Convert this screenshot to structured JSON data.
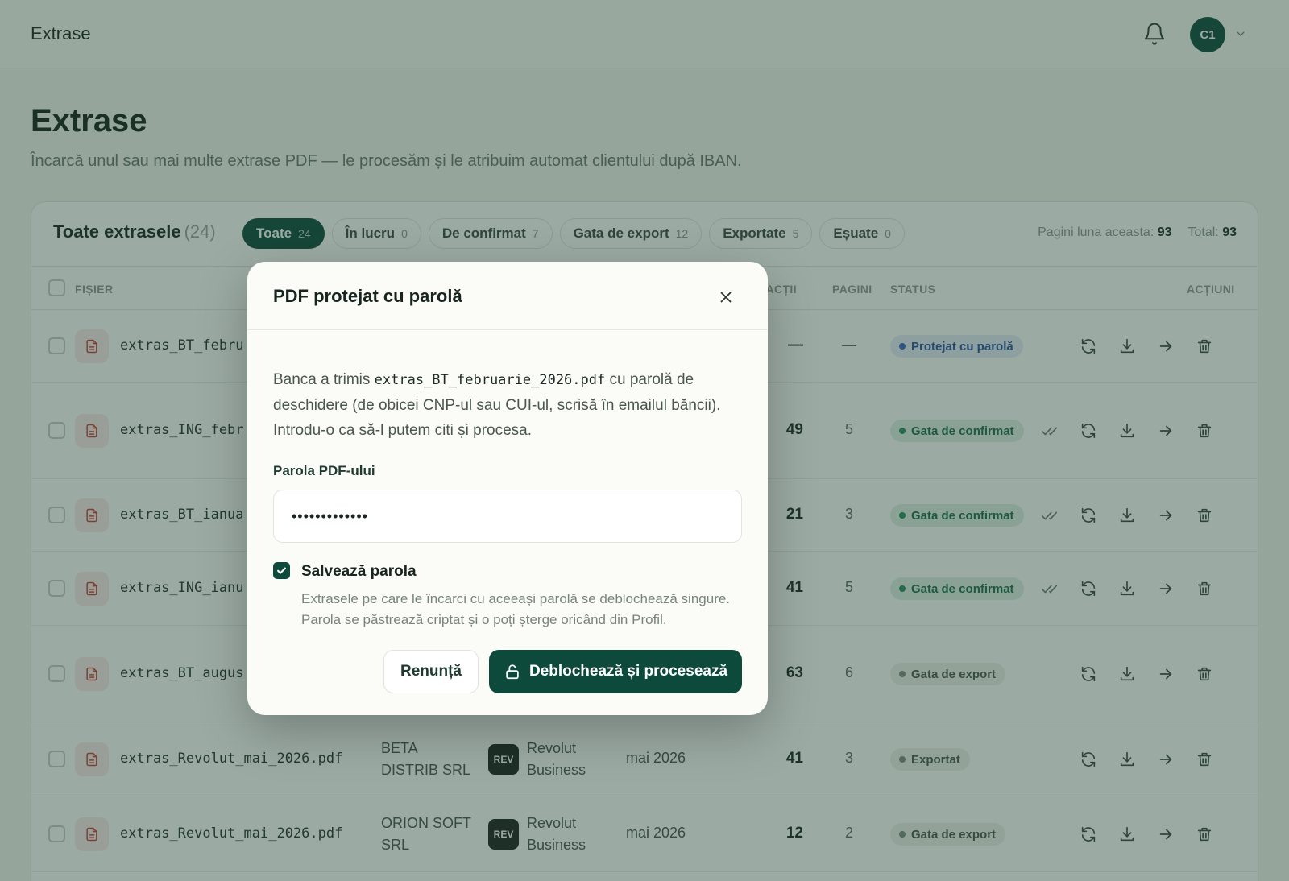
{
  "app": {
    "title": "Extrase",
    "avatar_initials": "C1"
  },
  "page": {
    "title": "Extrase",
    "subtitle": "Încarcă unul sau mai multe extrase PDF — le procesăm și le atribuim automat clientului după IBAN."
  },
  "card": {
    "title": "Toate extrasele",
    "count": "(24)",
    "tabs": [
      {
        "label": "Toate",
        "count": "24",
        "active": true
      },
      {
        "label": "În lucru",
        "count": "0"
      },
      {
        "label": "De confirmat",
        "count": "7"
      },
      {
        "label": "Gata de export",
        "count": "12"
      },
      {
        "label": "Exportate",
        "count": "5"
      },
      {
        "label": "Eșuate",
        "count": "0"
      }
    ],
    "stats": {
      "month_label": "Pagini luna aceasta:",
      "month_value": "93",
      "total_label": "Total:",
      "total_value": "93"
    }
  },
  "table": {
    "headers": {
      "file": "FIȘIER",
      "transactions": "NZACȚII",
      "pages": "PAGINI",
      "status": "STATUS",
      "actions": "ACȚIUNI"
    },
    "rows": [
      {
        "file": "extras_BT_febru",
        "client": "",
        "bank_logo": "",
        "bank": "",
        "period": "",
        "tx": "—",
        "pages": "—",
        "status": "Protejat cu parolă"
      },
      {
        "file": "extras_ING_febr",
        "client": "",
        "bank_logo": "",
        "bank": "",
        "period": "",
        "tx": "49",
        "pages": "5",
        "status": "Gata de confirmat"
      },
      {
        "file": "extras_BT_ianua",
        "client": "",
        "bank_logo": "",
        "bank": "",
        "period": "",
        "tx": "21",
        "pages": "3",
        "status": "Gata de confirmat"
      },
      {
        "file": "extras_ING_ianu",
        "client": "",
        "bank_logo": "",
        "bank": "",
        "period": "",
        "tx": "41",
        "pages": "5",
        "status": "Gata de confirmat"
      },
      {
        "file": "extras_BT_augus",
        "client": "",
        "bank_logo": "",
        "bank": "",
        "period": "",
        "tx": "63",
        "pages": "6",
        "status": "Gata de export"
      },
      {
        "file": "extras_Revolut_mai_2026.pdf",
        "client_l1": "BETA",
        "client_l2": "DISTRIB SRL",
        "bank_logo": "REV",
        "bank_l1": "Revolut",
        "bank_l2": "Business",
        "period": "mai 2026",
        "tx": "41",
        "pages": "3",
        "status": "Exportat"
      },
      {
        "file": "extras_Revolut_mai_2026.pdf",
        "client_l1": "ORION SOFT",
        "client_l2": "SRL",
        "bank_logo": "REV",
        "bank_l1": "Revolut",
        "bank_l2": "Business",
        "period": "mai 2026",
        "tx": "12",
        "pages": "2",
        "status": "Gata de export"
      }
    ]
  },
  "modal": {
    "title": "PDF protejat cu parolă",
    "desc_pre": "Banca a trimis ",
    "desc_file": "extras_BT_februarie_2026.pdf",
    "desc_post": " cu parolă de deschidere (de obicei CNP-ul sau CUI-ul, scrisă în emailul băncii). Introdu-o ca să-l putem citi și procesa.",
    "password_label": "Parola PDF-ului",
    "password_value": "•••••••••••••",
    "save_label": "Salvează parola",
    "save_help": "Extrasele pe care le încarci cu aceeași parolă se deblochează singure. Parola se păstrează criptat și o poți șterge oricând din Profil.",
    "cancel_label": "Renunță",
    "primary_label": "Deblochează și procesează"
  },
  "colors": {
    "brand": "#0e4a3b",
    "status_blue": "#3b63c4",
    "status_green": "#2c8a5c",
    "status_gray": "#7d8782"
  },
  "icons": [
    "bell-icon",
    "chevron-down-icon",
    "file-pdf-icon",
    "check-all-icon",
    "refresh-icon",
    "download-icon",
    "arrow-right-icon",
    "trash-icon",
    "close-icon",
    "unlock-icon",
    "checkmark-icon"
  ]
}
